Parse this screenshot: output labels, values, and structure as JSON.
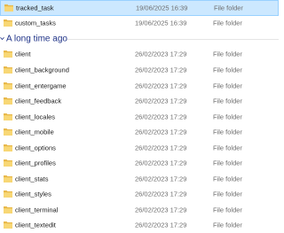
{
  "recent_items": [
    {
      "name": "tracked_task",
      "date": "19/06/2025 16:39",
      "type": "File folder",
      "selected": true
    },
    {
      "name": "custom_tasks",
      "date": "19/06/2025 16:39",
      "type": "File folder",
      "selected": false
    }
  ],
  "group": {
    "title": "A long time ago"
  },
  "old_items": [
    {
      "name": "client",
      "date": "26/02/2023 17:29",
      "type": "File folder"
    },
    {
      "name": "client_background",
      "date": "26/02/2023 17:29",
      "type": "File folder"
    },
    {
      "name": "client_entergame",
      "date": "26/02/2023 17:29",
      "type": "File folder"
    },
    {
      "name": "client_feedback",
      "date": "26/02/2023 17:29",
      "type": "File folder"
    },
    {
      "name": "client_locales",
      "date": "26/02/2023 17:29",
      "type": "File folder"
    },
    {
      "name": "client_mobile",
      "date": "26/02/2023 17:29",
      "type": "File folder"
    },
    {
      "name": "client_options",
      "date": "26/02/2023 17:29",
      "type": "File folder"
    },
    {
      "name": "client_profiles",
      "date": "26/02/2023 17:29",
      "type": "File folder"
    },
    {
      "name": "client_stats",
      "date": "26/02/2023 17:29",
      "type": "File folder"
    },
    {
      "name": "client_styles",
      "date": "26/02/2023 17:29",
      "type": "File folder"
    },
    {
      "name": "client_terminal",
      "date": "26/02/2023 17:29",
      "type": "File folder"
    },
    {
      "name": "client_textedit",
      "date": "26/02/2023 17:29",
      "type": "File folder"
    }
  ],
  "colors": {
    "folder_fill": "#f8d775",
    "folder_tab": "#e8b84a",
    "selection": "#cce8ff",
    "group_header": "#1e3287"
  }
}
